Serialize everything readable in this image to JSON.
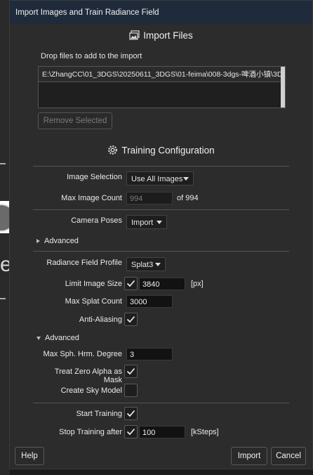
{
  "window": {
    "title": "Import Images and Train Radiance Field"
  },
  "import_files": {
    "title": "Import Files",
    "drop_label": "Drop files to add to the import",
    "files": [
      "E:\\ZhangCC\\01_3DGS\\20250611_3DGS\\01-feima\\008-3dgs-啤酒小镇\\3D("
    ],
    "remove_button": "Remove Selected"
  },
  "training": {
    "title": "Training Configuration",
    "image_selection": {
      "label": "Image Selection",
      "value": "Use All Images"
    },
    "max_image_count": {
      "label": "Max Image Count",
      "value": "994",
      "suffix": "of 994"
    },
    "camera_poses": {
      "label": "Camera Poses",
      "value": "Import"
    },
    "advanced_collapsed": "Advanced",
    "radiance_profile": {
      "label": "Radiance Field Profile",
      "value": "Splat3"
    },
    "limit_image_size": {
      "label": "Limit Image Size",
      "checked": true,
      "value": "3840",
      "unit": "[px]"
    },
    "max_splat_count": {
      "label": "Max Splat Count",
      "value": "3000"
    },
    "anti_aliasing": {
      "label": "Anti-Aliasing",
      "checked": true
    },
    "advanced_expanded": "Advanced",
    "max_sph_degree": {
      "label": "Max Sph. Hrm. Degree",
      "value": "3"
    },
    "treat_zero_alpha": {
      "label": "Treat Zero Alpha as Mask",
      "checked": true
    },
    "create_sky_model": {
      "label": "Create Sky Model",
      "checked": false
    },
    "start_training": {
      "label": "Start Training",
      "checked": true
    },
    "stop_training": {
      "label": "Stop Training after",
      "checked": true,
      "value": "100",
      "unit": "[kSteps]"
    }
  },
  "footer": {
    "help": "Help",
    "import": "Import",
    "cancel": "Cancel"
  },
  "background": {
    "text": "es"
  }
}
